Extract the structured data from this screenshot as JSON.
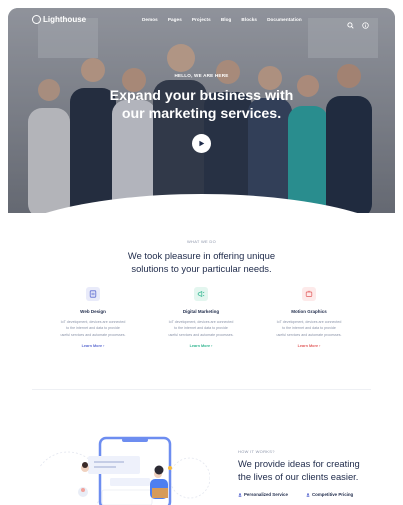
{
  "brand": {
    "name": "Lighthouse"
  },
  "nav": {
    "items": [
      "Demos",
      "Pages",
      "Projects",
      "Blog",
      "Blocks",
      "Documentation"
    ],
    "icons": [
      "search-icon",
      "info-icon"
    ]
  },
  "hero": {
    "eyebrow": "HELLO, WE ARE HERE",
    "title_line1": "Expand your business with",
    "title_line2": "our marketing services."
  },
  "services_section": {
    "eyebrow": "WHAT WE DO",
    "title_line1": "We took pleasure in offering unique",
    "title_line2": "solutions to your particular needs.",
    "items": [
      {
        "title": "Web Design",
        "desc_line1": "IoT development, devices are connected",
        "desc_line2": "to the internet and data to provide",
        "desc_line3": "useful services and automate processes.",
        "link": "Learn More",
        "color": "#5b6ad0"
      },
      {
        "title": "Digital Marketing",
        "desc_line1": "IoT development, devices are connected",
        "desc_line2": "to the internet and data to provide",
        "desc_line3": "useful services and automate processes.",
        "link": "Learn More",
        "color": "#2fb58f"
      },
      {
        "title": "Motion Graphics",
        "desc_line1": "IoT development, devices are connected",
        "desc_line2": "to the internet and data to provide",
        "desc_line3": "useful services and automate processes.",
        "link": "Learn More",
        "color": "#e25b5b"
      }
    ]
  },
  "how_it_works": {
    "eyebrow": "HOW IT WORKS?",
    "title_line1": "We provide ideas for creating",
    "title_line2": "the lives of our clients easier.",
    "features": [
      "Personalized Service",
      "Competitive Pricing"
    ]
  }
}
